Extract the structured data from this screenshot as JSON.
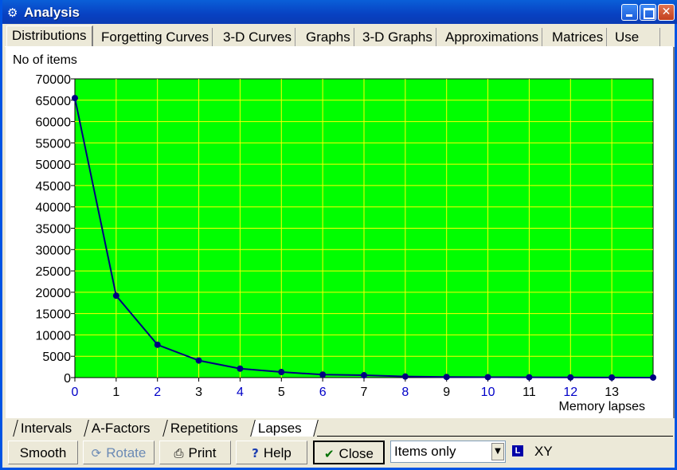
{
  "window": {
    "title": "Analysis",
    "app_icon": "tools-icon"
  },
  "tabs": [
    {
      "label": "Distributions",
      "active": true
    },
    {
      "label": "Forgetting Curves"
    },
    {
      "label": "3-D Curves"
    },
    {
      "label": "Graphs"
    },
    {
      "label": "3-D Graphs"
    },
    {
      "label": "Approximations"
    },
    {
      "label": "Matrices"
    },
    {
      "label": "Use"
    }
  ],
  "bottom_tabs": [
    {
      "label": "Intervals"
    },
    {
      "label": "A-Factors"
    },
    {
      "label": "Repetitions"
    },
    {
      "label": "Lapses",
      "active": true
    }
  ],
  "toolbar": {
    "smooth": "Smooth",
    "rotate": "Rotate",
    "print": "Print",
    "help": "Help",
    "close": "Close",
    "select_value": "Items only",
    "badge": "L",
    "xy": "XY"
  },
  "chart_data": {
    "type": "line",
    "ylabel": "No of items",
    "xlabel": "Memory lapses",
    "x": [
      0,
      1,
      2,
      3,
      4,
      5,
      6,
      7,
      8,
      9,
      10,
      11,
      12,
      13,
      14
    ],
    "x_tick_labels": [
      "0",
      "1",
      "2",
      "3",
      "4",
      "5",
      "6",
      "7",
      "8",
      "9",
      "10",
      "11",
      "12",
      "13"
    ],
    "values": [
      65500,
      19200,
      7700,
      4000,
      2100,
      1300,
      700,
      550,
      250,
      150,
      100,
      80,
      40,
      20,
      10
    ],
    "ylim": [
      0,
      70000
    ],
    "y_ticks": [
      0,
      5000,
      10000,
      15000,
      20000,
      25000,
      30000,
      35000,
      40000,
      45000,
      50000,
      55000,
      60000,
      65000,
      70000
    ],
    "plot_background": "#00ff00",
    "grid_color": "#ffff00",
    "line_color": "#000080",
    "grid": true
  }
}
